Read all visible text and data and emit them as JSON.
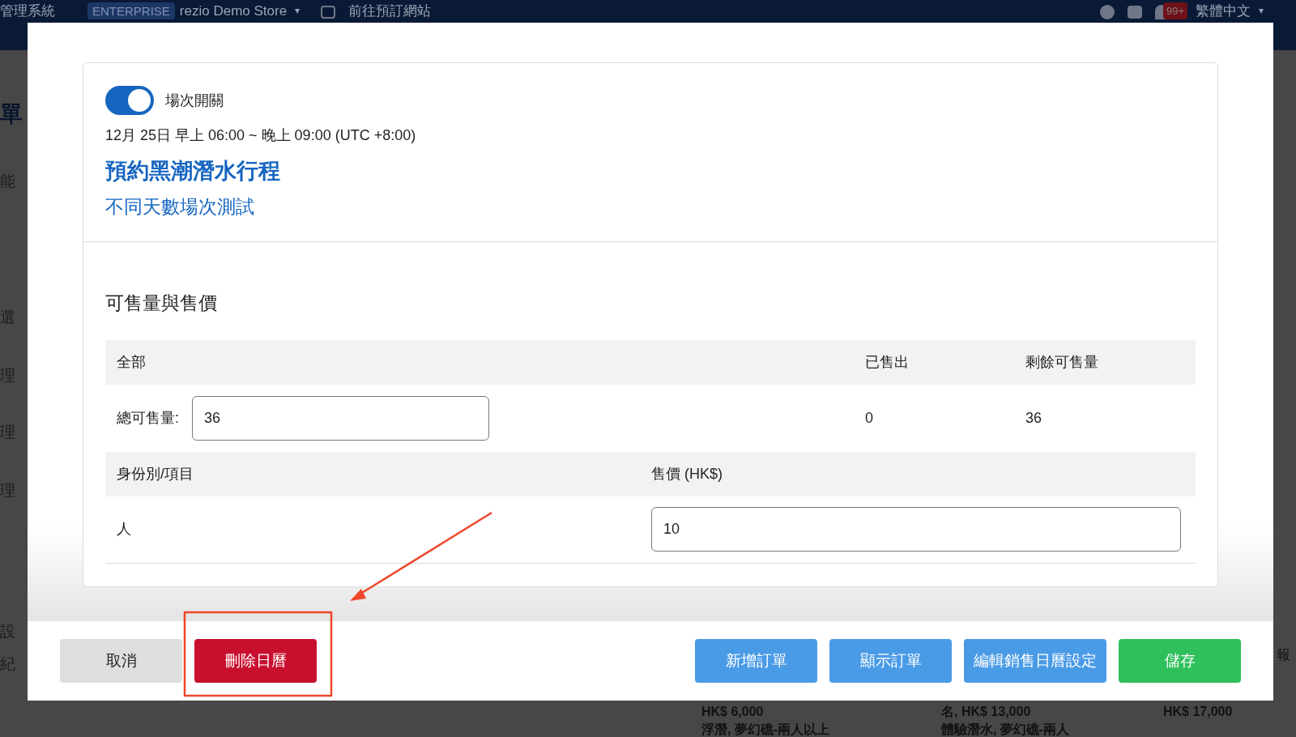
{
  "background": {
    "topbar": {
      "app_title": "管理系統",
      "badge": "ENTERPRISE",
      "store": "rezio Demo Store",
      "link": "前往預訂網站",
      "store_caret": "▾",
      "notification_count": "99+",
      "language": "繁體中文",
      "language_caret": "▾"
    },
    "sidebar": [
      "單",
      "能",
      "選",
      "理",
      "理",
      "理",
      "設",
      "紀"
    ],
    "right_text": "報",
    "calendar_texts": [
      {
        "line1": "HK$ 6,000",
        "line2": "浮潛, 夢幻礁-兩人以上"
      },
      {
        "line1": "名, HK$ 13,000",
        "line2": "體驗潛水, 夢幻礁-兩人"
      },
      {
        "line1": "HK$ 17,000"
      }
    ]
  },
  "dialog": {
    "session_toggle": {
      "label": "場次開關",
      "on": true
    },
    "datetime": "12月 25日 早上 06:00 ~ 晚上 09:00 (UTC +8:00)",
    "product": "預約黑潮潛水行程",
    "plan": "不同天數場次測試",
    "section_title": "可售量與售價",
    "stock_table": {
      "columns": [
        "全部",
        "已售出",
        "剩餘可售量"
      ],
      "total_label": "總可售量:",
      "total_value": "36",
      "sold": "0",
      "remaining": "36"
    },
    "price_table": {
      "columns": [
        "身份別/項目",
        "售價 (HK$)"
      ],
      "rows": [
        {
          "item": "人",
          "price": "10"
        }
      ]
    },
    "buttons": [
      {
        "label": "取消",
        "kind": "secondary"
      },
      {
        "label": "刪除日曆",
        "kind": "danger"
      },
      {
        "label": "新增訂單",
        "kind": "primary"
      },
      {
        "label": "顯示訂單",
        "kind": "primary"
      },
      {
        "label": "編輯銷售日曆設定",
        "kind": "primary"
      },
      {
        "label": "儲存",
        "kind": "success"
      }
    ]
  }
}
